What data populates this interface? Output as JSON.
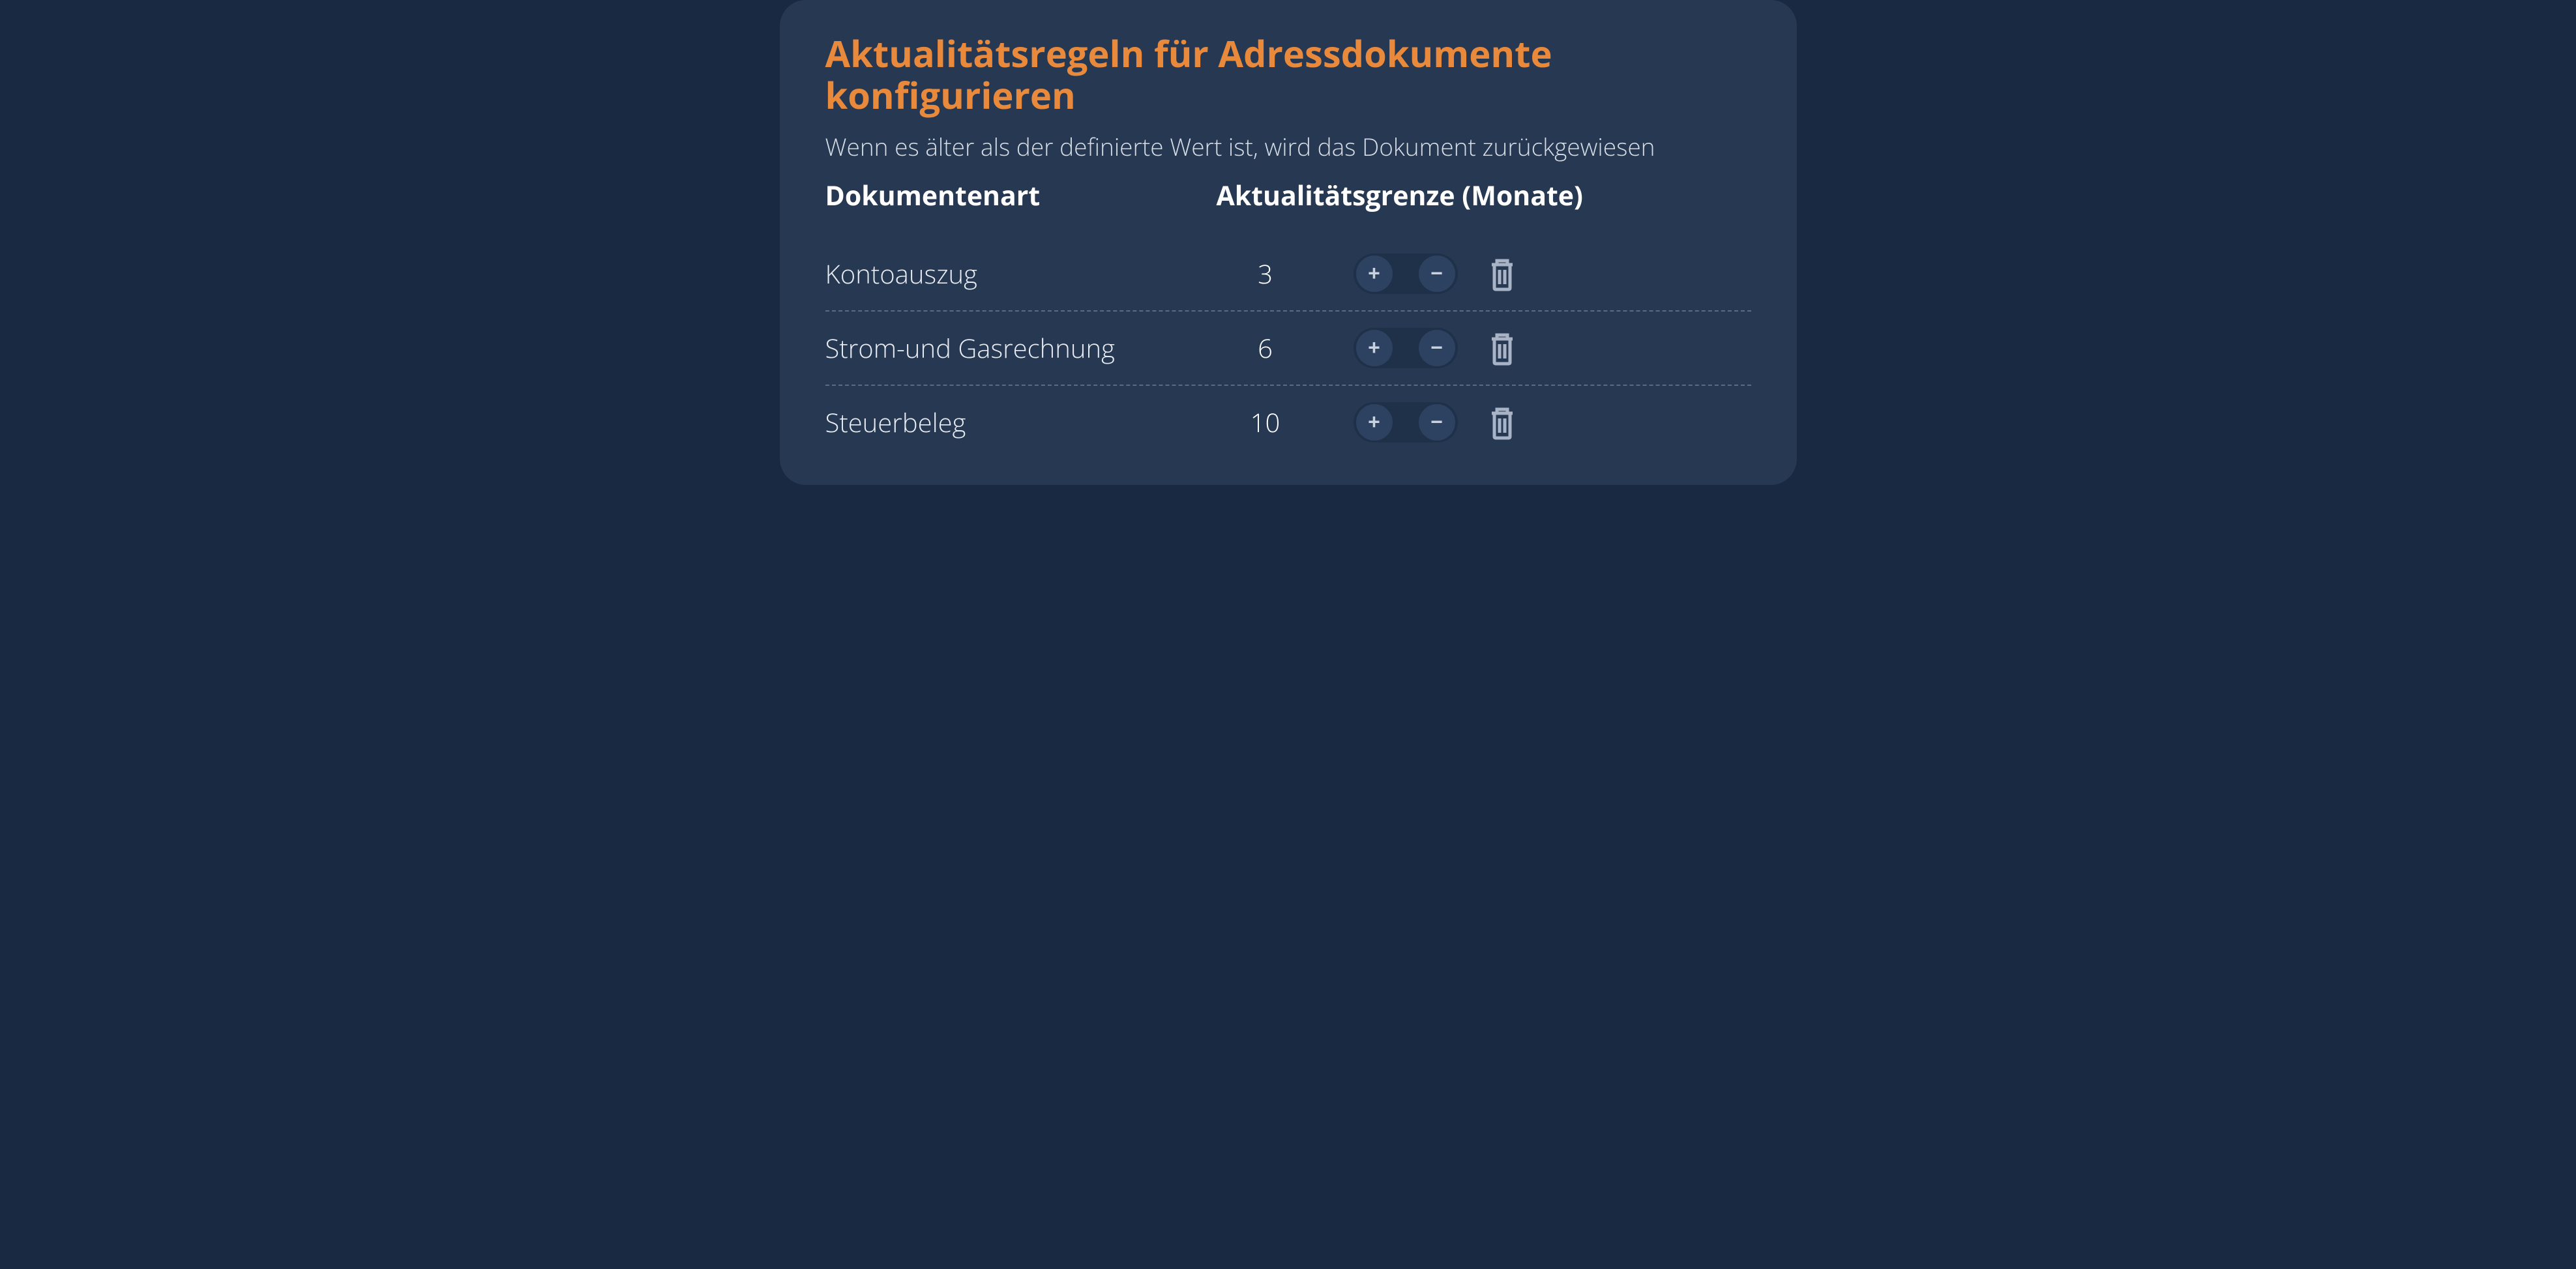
{
  "panel": {
    "title": "Aktualitätsregeln für Adressdokumente konfigurieren",
    "subtitle": "Wenn es älter als der definierte Wert ist, wird das Dokument zurückgewiesen",
    "headers": {
      "doctype": "Dokumentenart",
      "limit": "Aktualitätsgrenze (Monate)"
    },
    "rows": [
      {
        "label": "Kontoauszug",
        "value": "3"
      },
      {
        "label": "Strom-und Gasrechnung",
        "value": "6"
      },
      {
        "label": "Steuerbeleg",
        "value": "10"
      }
    ],
    "icons": {
      "plus": "+",
      "minus": "−"
    }
  }
}
